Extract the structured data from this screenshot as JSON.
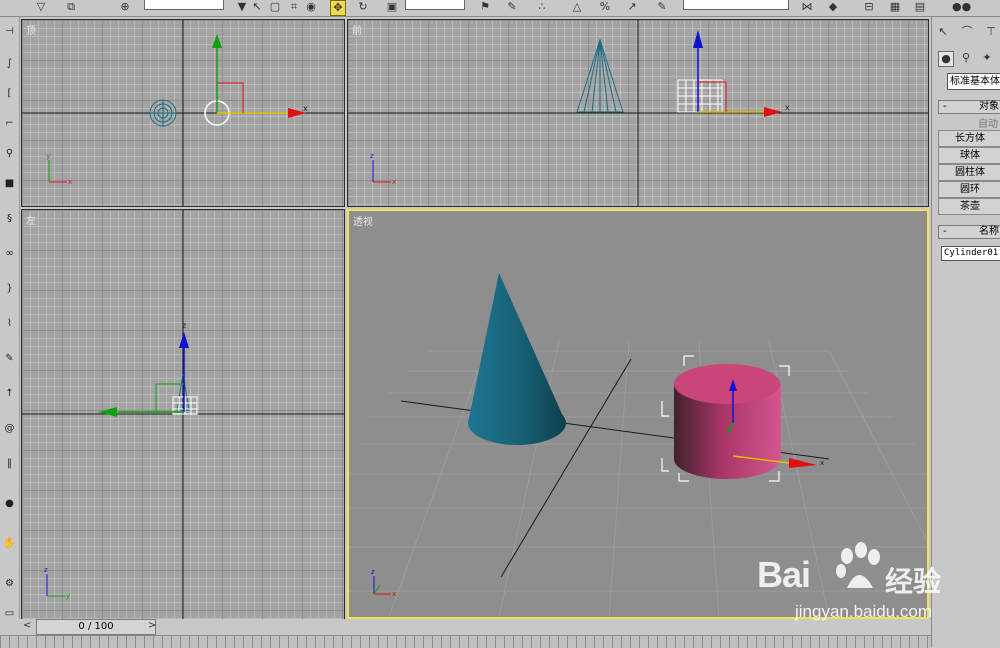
{
  "viewports": {
    "top": {
      "label": "顶"
    },
    "front": {
      "label": "前"
    },
    "left": {
      "label": "左"
    },
    "perspective": {
      "label": "透视"
    }
  },
  "axis_labels": {
    "x": "x",
    "y": "y",
    "z": "z"
  },
  "command_panel": {
    "category_dropdown": "标准基本体",
    "object_type_rollout": "对象",
    "autogrid_label": "自动",
    "buttons": [
      "长方体",
      "球体",
      "圆柱体",
      "圆环",
      "茶壶"
    ],
    "name_rollout": "名称",
    "name_field": "Cylinder01"
  },
  "time_slider": {
    "text": "0 / 100"
  },
  "watermark": {
    "brand": "Bai",
    "brand_cn": "经验",
    "url": "jingyan.baidu.com"
  },
  "colors": {
    "viewport_bg": "#a3a3a3",
    "perspective_bg": "#8e8e8e",
    "active_border": "#f2e25a",
    "cone": "#1c6d80",
    "cylinder": "#c9457a",
    "axis_x": "#e01010",
    "axis_y": "#12a012",
    "axis_z": "#1010d0"
  },
  "icons": [
    "select-icon",
    "move-icon",
    "rotate-icon",
    "scale-icon",
    "undo-icon",
    "link-icon",
    "create-geometry-icon",
    "shapes-icon"
  ]
}
